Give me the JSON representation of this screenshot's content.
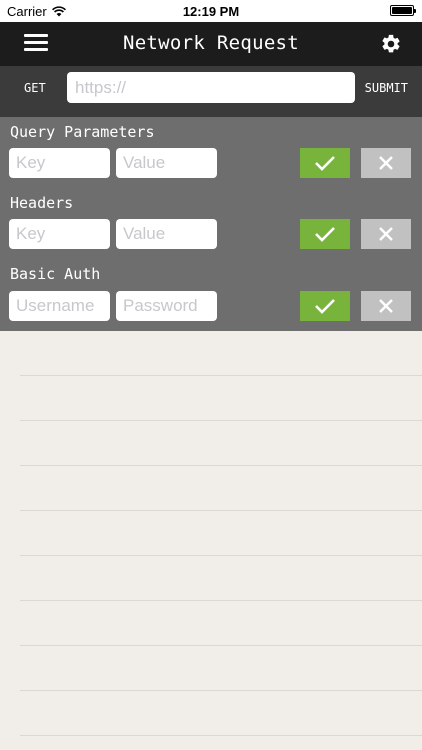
{
  "status_bar": {
    "carrier": "Carrier",
    "time": "12:19 PM"
  },
  "nav": {
    "title": "Network Request",
    "left_icon": "menu-icon",
    "right_icon": "gear-icon"
  },
  "request": {
    "method": "GET",
    "url_placeholder": "https://",
    "url_value": "",
    "submit_label": "SUBMIT"
  },
  "sections": {
    "query": {
      "title": "Query Parameters",
      "key_placeholder": "Key",
      "value_placeholder": "Value"
    },
    "headers": {
      "title": "Headers",
      "key_placeholder": "Key",
      "value_placeholder": "Value"
    },
    "auth": {
      "title": "Basic Auth",
      "username_placeholder": "Username",
      "password_placeholder": "Password"
    }
  },
  "colors": {
    "nav_bg": "#1c1c1c",
    "request_bar_bg": "#3b3b3b",
    "panel_bg": "#6e6e6e",
    "confirm_green": "#78b43c",
    "cancel_gray": "#c1c1c1",
    "body_bg": "#f1eeea"
  }
}
